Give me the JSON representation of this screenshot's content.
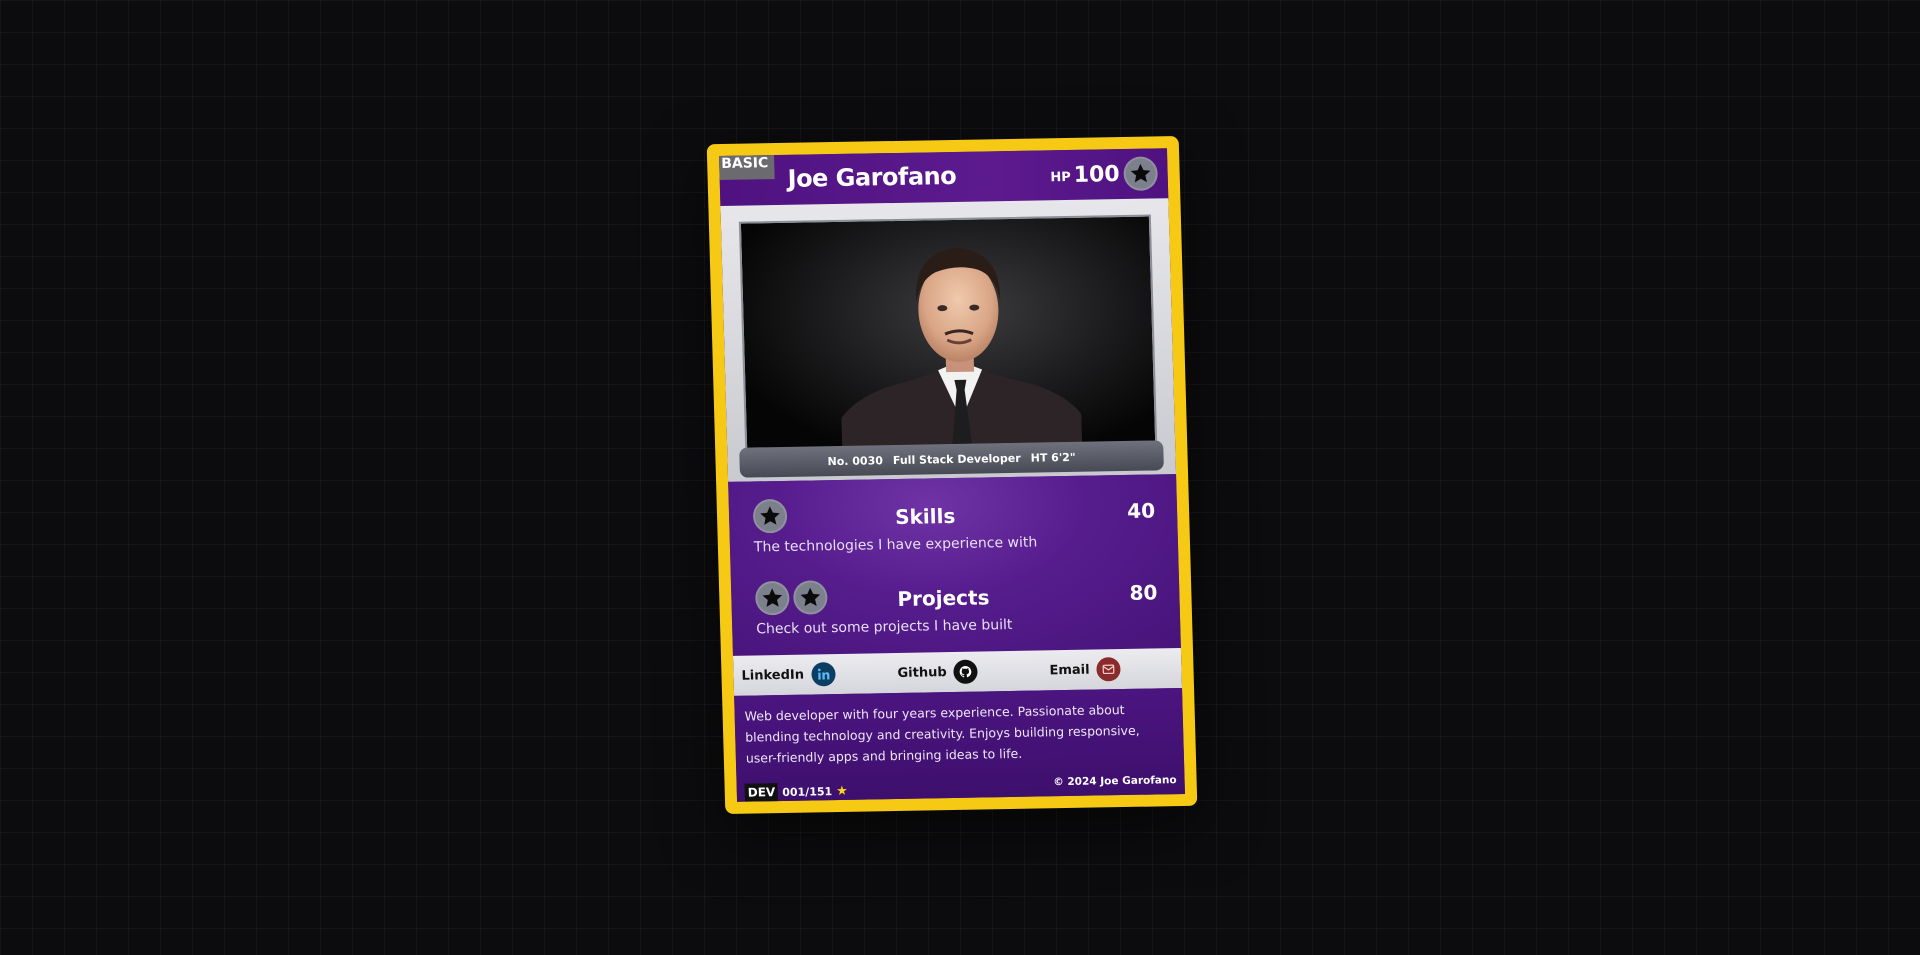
{
  "card": {
    "stage_badge": "BASIC",
    "name": "Joe Garofano",
    "hp_label": "HP",
    "hp_value": "100",
    "info": {
      "number": "No. 0030",
      "role": "Full Stack Developer",
      "height": "HT 6'2\""
    },
    "attacks": [
      {
        "title": "Skills",
        "cost_count": 1,
        "damage": "40",
        "description": "The technologies I have experience with"
      },
      {
        "title": "Projects",
        "cost_count": 2,
        "damage": "80",
        "description": "Check out some projects I have built"
      }
    ],
    "links": [
      {
        "label": "LinkedIn",
        "icon": "linkedin-icon",
        "color": "#0b5c8a"
      },
      {
        "label": "Github",
        "icon": "github-icon",
        "color": "#111111"
      },
      {
        "label": "Email",
        "icon": "email-icon",
        "color": "#b23a3a"
      }
    ],
    "flavor_text": "Web developer with four years experience. Passionate about blending technology and creativity. Enjoys building responsive, user-friendly apps and bringing ideas to life.",
    "set_code": "DEV",
    "set_number": "001/151",
    "rarity_symbol": "★",
    "copyright": "© 2024 Joe Garofano"
  },
  "colors": {
    "border": "#f6c915",
    "card_purple": "#4a1577",
    "energy_circle": "#7c7f8c",
    "background": "#0c0c0e"
  }
}
